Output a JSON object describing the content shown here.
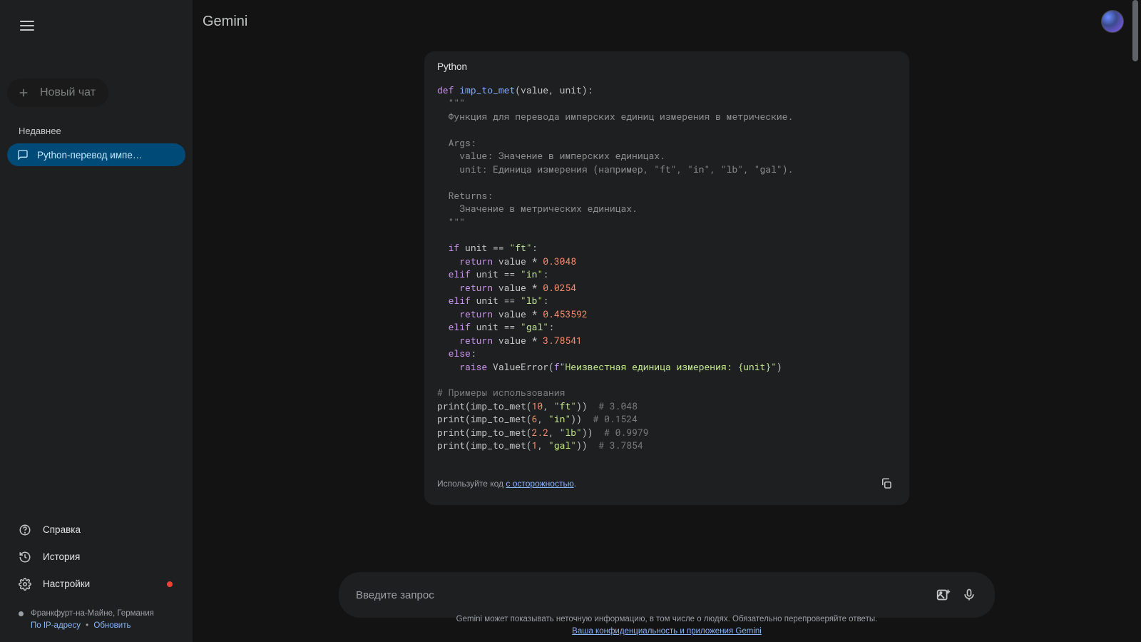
{
  "app_title": "Gemini",
  "sidebar": {
    "new_chat_label": "Новый чат",
    "recent_label": "Недавнее",
    "chat_item_label": "Python-перевод импе…",
    "help_label": "Справка",
    "history_label": "История",
    "settings_label": "Настройки",
    "location_line": "Франкфурт-на-Майне, Германия",
    "ip_label": "По IP-адресу",
    "update_label": "Обновить"
  },
  "code": {
    "language_label": "Python",
    "tokens": [
      [
        [
          "kw",
          "def"
        ],
        [
          "",
          " "
        ],
        [
          "fn",
          "imp_to_met"
        ],
        [
          "",
          "(value, unit):"
        ]
      ],
      [
        [
          "",
          "  "
        ],
        [
          "doc",
          "\"\"\""
        ]
      ],
      [
        [
          "",
          "  "
        ],
        [
          "doc",
          "Функция для перевода имперских единиц измерения в метрические."
        ]
      ],
      [
        [
          "",
          ""
        ]
      ],
      [
        [
          "",
          "  "
        ],
        [
          "doc",
          "Args:"
        ]
      ],
      [
        [
          "",
          "    "
        ],
        [
          "doc",
          "value: Значение в имперских единицах."
        ]
      ],
      [
        [
          "",
          "    "
        ],
        [
          "doc",
          "unit: Единица измерения (например, \"ft\", \"in\", \"lb\", \"gal\")."
        ]
      ],
      [
        [
          "",
          ""
        ]
      ],
      [
        [
          "",
          "  "
        ],
        [
          "doc",
          "Returns:"
        ]
      ],
      [
        [
          "",
          "    "
        ],
        [
          "doc",
          "Значение в метрических единицах."
        ]
      ],
      [
        [
          "",
          "  "
        ],
        [
          "doc",
          "\"\"\""
        ]
      ],
      [
        [
          "",
          ""
        ]
      ],
      [
        [
          "",
          "  "
        ],
        [
          "kw",
          "if"
        ],
        [
          "",
          " unit == "
        ],
        [
          "str",
          "\"ft\""
        ],
        [
          "",
          ":"
        ]
      ],
      [
        [
          "",
          "    "
        ],
        [
          "kw",
          "return"
        ],
        [
          "",
          " value * "
        ],
        [
          "num",
          "0.3048"
        ]
      ],
      [
        [
          "",
          "  "
        ],
        [
          "kw",
          "elif"
        ],
        [
          "",
          " unit == "
        ],
        [
          "str",
          "\"in\""
        ],
        [
          "",
          ":"
        ]
      ],
      [
        [
          "",
          "    "
        ],
        [
          "kw",
          "return"
        ],
        [
          "",
          " value * "
        ],
        [
          "num",
          "0.0254"
        ]
      ],
      [
        [
          "",
          "  "
        ],
        [
          "kw",
          "elif"
        ],
        [
          "",
          " unit == "
        ],
        [
          "str",
          "\"lb\""
        ],
        [
          "",
          ":"
        ]
      ],
      [
        [
          "",
          "    "
        ],
        [
          "kw",
          "return"
        ],
        [
          "",
          " value * "
        ],
        [
          "num",
          "0.453592"
        ]
      ],
      [
        [
          "",
          "  "
        ],
        [
          "kw",
          "elif"
        ],
        [
          "",
          " unit == "
        ],
        [
          "str",
          "\"gal\""
        ],
        [
          "",
          ":"
        ]
      ],
      [
        [
          "",
          "    "
        ],
        [
          "kw",
          "return"
        ],
        [
          "",
          " value * "
        ],
        [
          "num",
          "3.78541"
        ]
      ],
      [
        [
          "",
          "  "
        ],
        [
          "kw",
          "else"
        ],
        [
          "",
          ":"
        ]
      ],
      [
        [
          "",
          "    "
        ],
        [
          "kw",
          "raise"
        ],
        [
          "",
          " ValueError("
        ],
        [
          "kw",
          "f"
        ],
        [
          "str",
          "\"Неизвестная единица измерения: {unit}\""
        ],
        [
          "",
          ")"
        ]
      ],
      [
        [
          "",
          ""
        ]
      ],
      [
        [
          "cm",
          "# Примеры использования"
        ]
      ],
      [
        [
          "",
          "print(imp_to_met("
        ],
        [
          "num",
          "10"
        ],
        [
          "",
          ", "
        ],
        [
          "str",
          "\"ft\""
        ],
        [
          "",
          "))  "
        ],
        [
          "cm",
          "# 3.048"
        ]
      ],
      [
        [
          "",
          "print(imp_to_met("
        ],
        [
          "num",
          "6"
        ],
        [
          "",
          ", "
        ],
        [
          "str",
          "\"in\""
        ],
        [
          "",
          "))  "
        ],
        [
          "cm",
          "# 0.1524"
        ]
      ],
      [
        [
          "",
          "print(imp_to_met("
        ],
        [
          "num",
          "2.2"
        ],
        [
          "",
          ", "
        ],
        [
          "str",
          "\"lb\""
        ],
        [
          "",
          "))  "
        ],
        [
          "cm",
          "# 0.9979"
        ]
      ],
      [
        [
          "",
          "print(imp_to_met("
        ],
        [
          "num",
          "1"
        ],
        [
          "",
          ", "
        ],
        [
          "str",
          "\"gal\""
        ],
        [
          "",
          "))  "
        ],
        [
          "cm",
          "# 3.7854"
        ]
      ]
    ],
    "caution_prefix": "Используйте код ",
    "caution_link": "с осторожностью",
    "caution_suffix": "."
  },
  "input": {
    "placeholder": "Введите запрос"
  },
  "disclaimer": {
    "line1": "Gemini может показывать неточную информацию, в том числе о людях. Обязательно перепроверяйте ответы.",
    "line2_link": "Ваша конфиденциальность и приложения Gemini"
  }
}
